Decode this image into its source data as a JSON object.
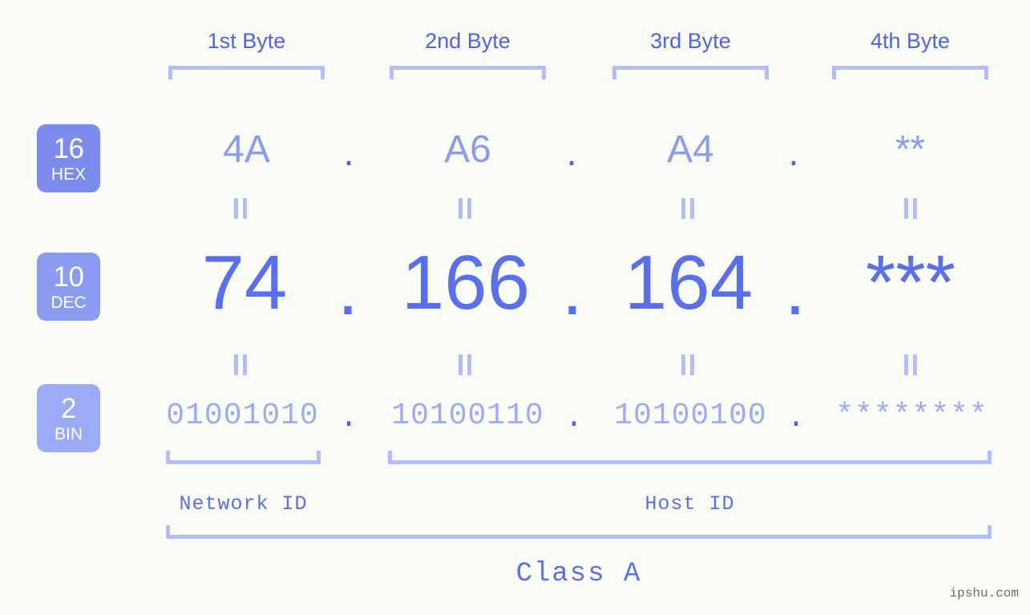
{
  "meta": {
    "background_color": "#fbfdf7",
    "accent_color": "#5a6ff0",
    "light_accent_color": "#b3bdfa",
    "watermark": "ipshu.com"
  },
  "byte_headers": [
    {
      "label": "1st Byte"
    },
    {
      "label": "2nd Byte"
    },
    {
      "label": "3rd Byte"
    },
    {
      "label": "4th Byte"
    }
  ],
  "radix_rows": [
    {
      "badge": {
        "base": "16",
        "name": "HEX",
        "color": "#7b8ced"
      },
      "values": [
        "4A",
        "A6",
        "A4",
        "**"
      ],
      "separator": "."
    },
    {
      "badge": {
        "base": "10",
        "name": "DEC",
        "color": "#8b9bf2"
      },
      "values": [
        "74",
        "166",
        "164",
        "***"
      ],
      "separator": "."
    },
    {
      "badge": {
        "base": "2",
        "name": "BIN",
        "color": "#9cabf7"
      },
      "values": [
        "01001010",
        "10100110",
        "10100100",
        "********"
      ],
      "separator": "."
    }
  ],
  "connectors": {
    "glyph": "||",
    "rows": [
      "hex-to-dec",
      "dec-to-bin"
    ]
  },
  "segments": {
    "network_id": "Network ID",
    "host_id": "Host ID",
    "class": "Class A"
  }
}
